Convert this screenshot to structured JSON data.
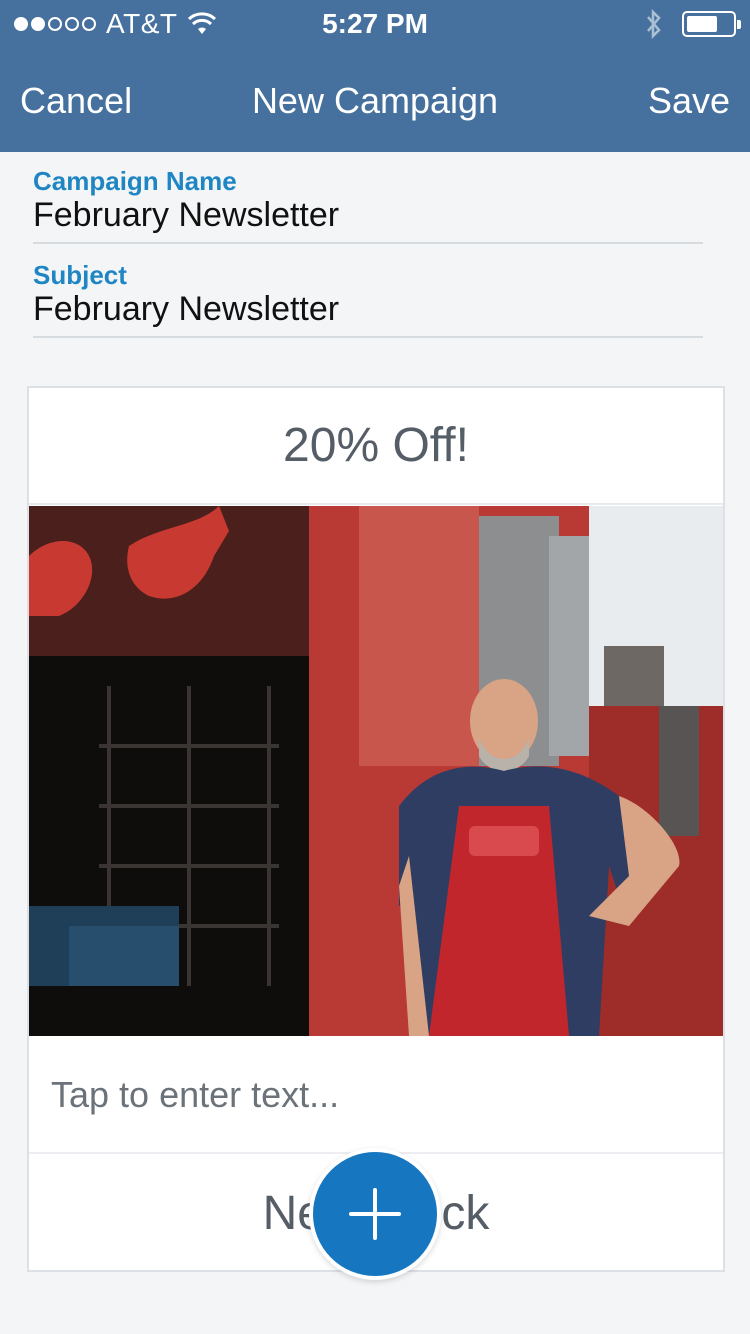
{
  "status_bar": {
    "carrier": "AT&T",
    "time": "5:27 PM",
    "signal_icon": "signal-dots-icon",
    "wifi_icon": "wifi-icon",
    "bluetooth_icon": "bluetooth-icon",
    "battery_icon": "battery-icon"
  },
  "nav": {
    "cancel_label": "Cancel",
    "title": "New Campaign",
    "save_label": "Save"
  },
  "form": {
    "campaign_name_label": "Campaign Name",
    "campaign_name_value": "February Newsletter",
    "subject_label": "Subject",
    "subject_value": "February Newsletter"
  },
  "content": {
    "headline": "20% Off!",
    "image_description": "photo-block",
    "text_placeholder": "Tap to enter text...",
    "new_block_label": "New Block",
    "add_icon": "plus-icon"
  },
  "colors": {
    "nav_background": "#46719f",
    "label_blue": "#1f86c3",
    "fab_blue": "#1677c0",
    "page_background": "#f3f5f7"
  }
}
